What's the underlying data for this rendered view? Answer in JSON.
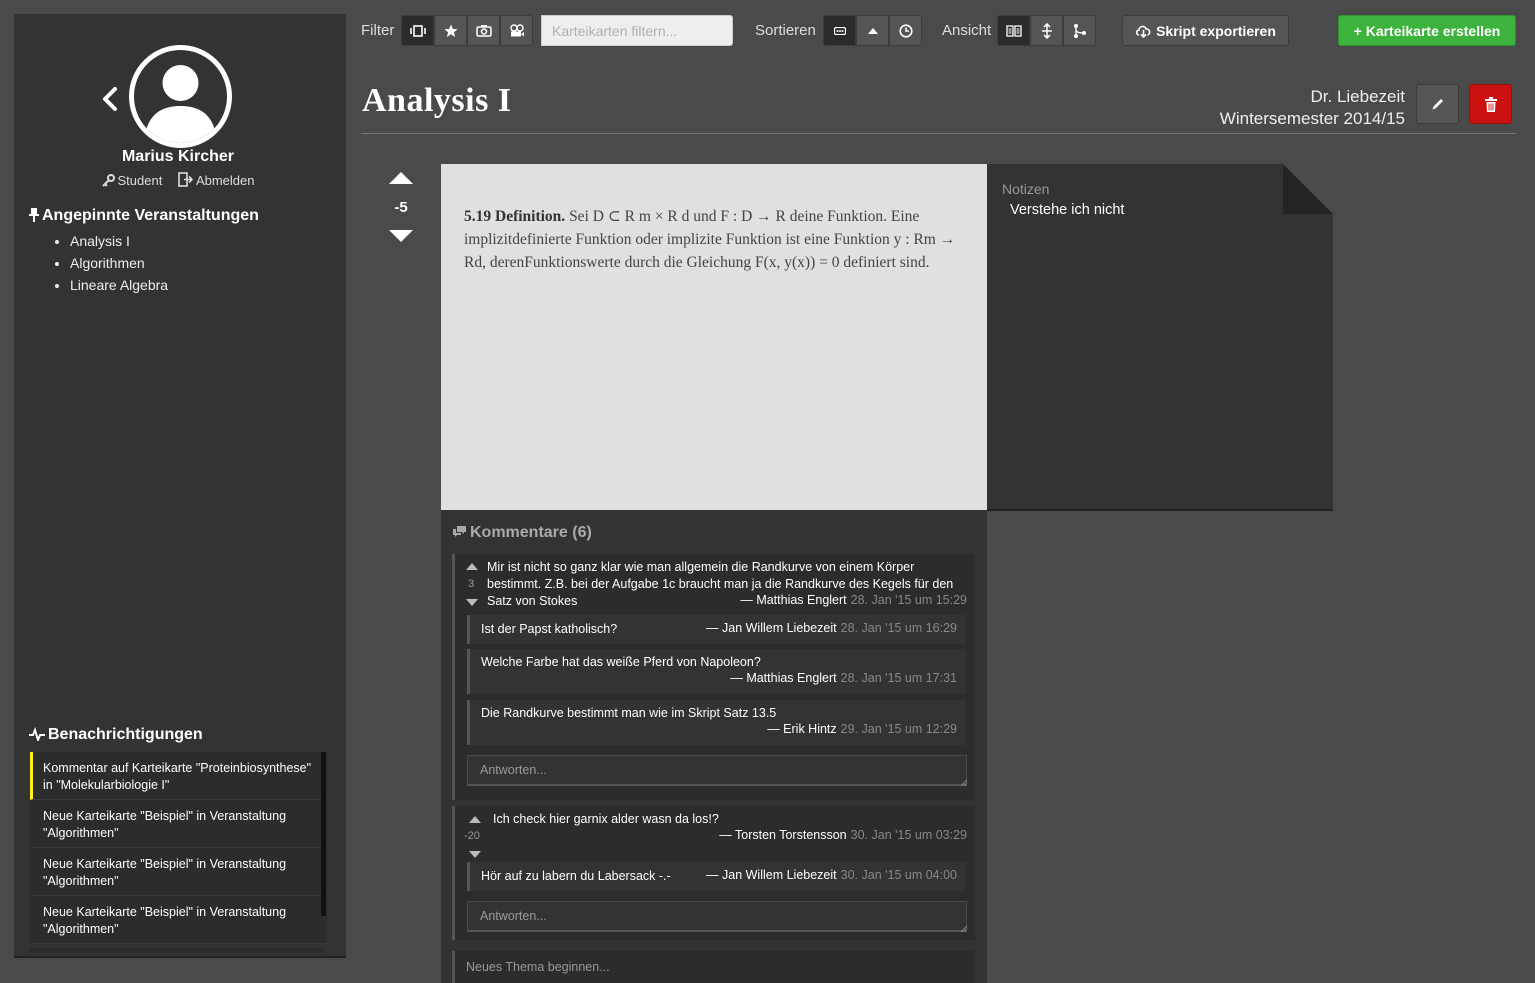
{
  "sidebar": {
    "user": {
      "name": "Marius Kircher",
      "role": "Student",
      "logout": "Abmelden"
    },
    "pinned": {
      "title": "Angepinnte Veranstaltungen",
      "items": [
        "Analysis I",
        "Algorithmen",
        "Lineare Algebra"
      ]
    },
    "notifications": {
      "title": "Benachrichtigungen",
      "items": [
        {
          "text": "Kommentar auf Karteikarte \"Proteinbiosynthese\" in \"Molekularbiologie I\"",
          "unread": true
        },
        {
          "text": "Neue Karteikarte \"Beispiel\" in Veranstaltung \"Algorithmen\"",
          "unread": false
        },
        {
          "text": "Neue Karteikarte \"Beispiel\" in Veranstaltung \"Algorithmen\"",
          "unread": false
        },
        {
          "text": "Neue Karteikarte \"Beispiel\" in Veranstaltung \"Algorithmen\"",
          "unread": false
        }
      ],
      "unread_color": "#ffee22"
    }
  },
  "toolbar": {
    "filter_label": "Filter",
    "filter_placeholder": "Karteikarten filtern...",
    "sort_label": "Sortieren",
    "view_label": "Ansicht",
    "export_label": "Skript exportieren",
    "create_label": "+ Karteikarte erstellen",
    "create_color": "#3db33d",
    "filter_icons": [
      "cards-icon",
      "star-icon",
      "camera-icon",
      "video-icon"
    ],
    "sort_icons": [
      "ellipsis-icon",
      "triangle-up-icon",
      "clock-icon"
    ],
    "view_icons": [
      "book-icon",
      "expand-icon",
      "branch-icon"
    ]
  },
  "course": {
    "title": "Analysis I",
    "lecturer": "Dr. Liebezeit",
    "semester": "Wintersemester 2014/15",
    "delete_color": "#cc1111"
  },
  "card": {
    "votes": "-5",
    "label": "5.19 Definition.",
    "text": "Sei D ⊂ R m × R d und F : D → R deine Funktion. Eine implizitdefinierte Funktion oder implizite Funktion ist eine Funktion y : Rm → Rd, derenFunktionswerte durch die Gleichung F(x, y(x)) = 0 definiert sind."
  },
  "notes": {
    "label": "Notizen",
    "text": "Verstehe ich nicht"
  },
  "comments": {
    "title": "Kommentare (6)",
    "threads": [
      {
        "votes": "3",
        "text": "Mir ist nicht so ganz klar wie man allgemein die Randkurve von einem Körper bestimmt. Z.B. bei der Aufgabe 1c braucht man ja die Randkurve des Kegels für den Satz von Stokes",
        "author": "— Matthias Englert",
        "date": "28. Jan '15 um 15:29",
        "replies": [
          {
            "text": "Ist der Papst katholisch?",
            "author": "— Jan Willem Liebezeit",
            "date": "28. Jan '15 um 16:29"
          },
          {
            "text": "Welche Farbe hat das weiße Pferd von Napoleon?",
            "author": "— Matthias Englert",
            "date": "28. Jan '15 um 17:31"
          },
          {
            "text": "Die Randkurve bestimmt man wie im Skript Satz 13.5",
            "author": "— Erik Hintz",
            "date": "29. Jan '15 um 12:29"
          }
        ],
        "reply_placeholder": "Antworten..."
      },
      {
        "votes": "-20",
        "text": "Ich check hier garnix alder wasn da los!?",
        "author": "— Torsten Torstensson",
        "date": "30. Jan '15 um 03:29",
        "replies": [
          {
            "text": "Hör auf zu labern du Labersack -.-",
            "author": "— Jan Willem Liebezeit",
            "date": "30. Jan '15 um 04:00"
          }
        ],
        "reply_placeholder": "Antworten..."
      }
    ],
    "new_topic_placeholder": "Neues Thema beginnen..."
  }
}
